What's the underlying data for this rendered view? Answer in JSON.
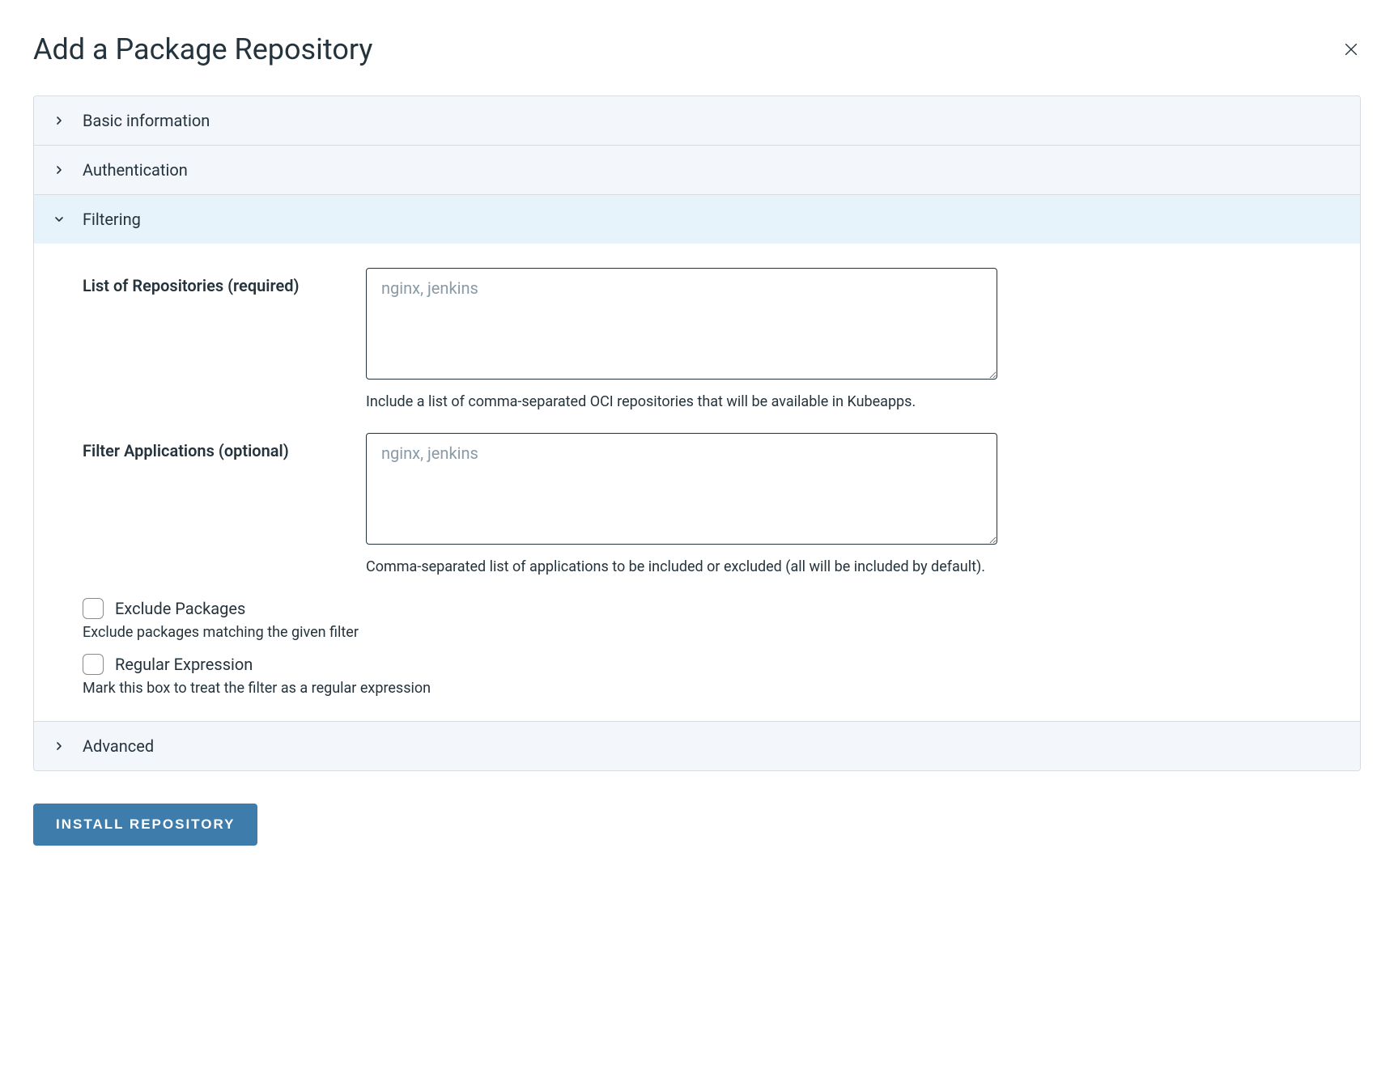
{
  "modal": {
    "title": "Add a Package Repository"
  },
  "sections": {
    "basic_info": {
      "label": "Basic information"
    },
    "authentication": {
      "label": "Authentication"
    },
    "filtering": {
      "label": "Filtering",
      "list_repos_label": "List of Repositories (required)",
      "list_repos_placeholder": "nginx, jenkins",
      "list_repos_help": "Include a list of comma-separated OCI repositories that will be available in Kubeapps.",
      "filter_apps_label": "Filter Applications (optional)",
      "filter_apps_placeholder": "nginx, jenkins",
      "filter_apps_help": "Comma-separated list of applications to be included or excluded (all will be included by default).",
      "exclude_label": "Exclude Packages",
      "exclude_help": "Exclude packages matching the given filter",
      "regex_label": "Regular Expression",
      "regex_help": "Mark this box to treat the filter as a regular expression"
    },
    "advanced": {
      "label": "Advanced"
    }
  },
  "footer": {
    "install_label": "INSTALL REPOSITORY"
  }
}
